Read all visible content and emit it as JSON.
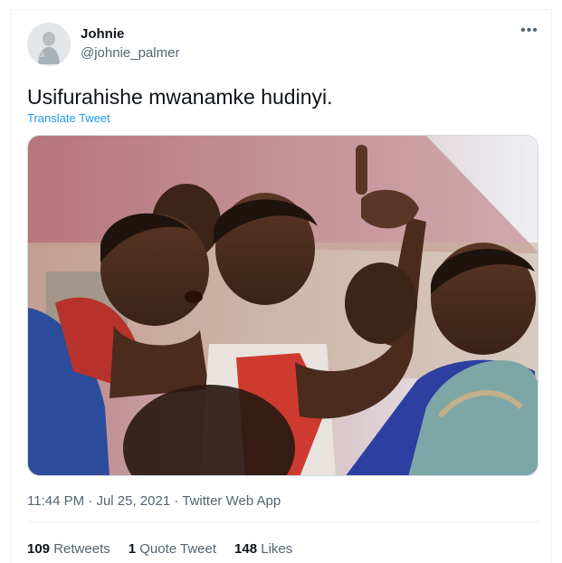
{
  "author": {
    "name": "Johnie",
    "handle": "@johnie_palmer"
  },
  "tweet": {
    "text": "Usifurahishe mwanamke hudinyi.",
    "translate_label": "Translate Tweet"
  },
  "more_icon": "ellipsis-icon",
  "meta": {
    "time": "11:44 PM",
    "date": "Jul 25, 2021",
    "source": "Twitter Web App",
    "separator": "·"
  },
  "stats": {
    "retweets_count": "109",
    "retweets_label": "Retweets",
    "quotes_count": "1",
    "quotes_label": "Quote Tweet",
    "likes_count": "148",
    "likes_label": "Likes"
  },
  "colors": {
    "link": "#1d9bf0",
    "secondary_text": "#536471",
    "primary_text": "#0f1419"
  }
}
